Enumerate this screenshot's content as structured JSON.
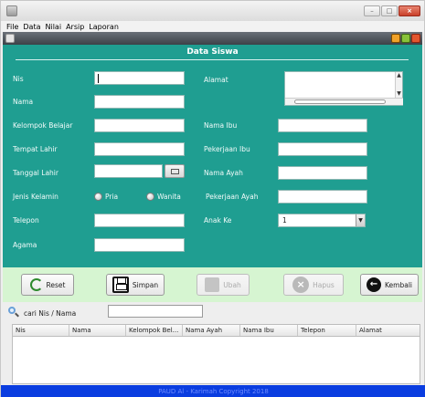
{
  "menu": [
    "File",
    "Data",
    "Nilai",
    "Arsip",
    "Laporan"
  ],
  "form": {
    "title": "Data Siswa",
    "left_labels": [
      "Nis",
      "Nama",
      "Kelompok Belajar",
      "Tempat Lahir",
      "Tanggal Lahir",
      "Jenis Kelamin",
      "Telepon",
      "Agama"
    ],
    "right_labels": [
      "Alamat",
      "Nama Ibu",
      "Pekerjaan Ibu",
      "Nama Ayah",
      "Pekerjaan Ayah",
      "Anak Ke"
    ],
    "gender_options": [
      "Pria",
      "Wanita"
    ],
    "anak_ke_value": "1"
  },
  "buttons": {
    "reset": "Reset",
    "simpan": "Simpan",
    "ubah": "Ubah",
    "hapus": "Hapus",
    "kembali": "Kembali"
  },
  "search": {
    "label": "cari Nis / Nama",
    "value": ""
  },
  "table": {
    "columns": [
      "Nis",
      "Nama",
      "Kelompok Bel...",
      "Nama Ayah",
      "Nama Ibu",
      "Telepon",
      "Alamat"
    ]
  },
  "footer": "PAUD Al - Karimah Copyright 2018",
  "colors": {
    "panel": "#1f9e91",
    "button_bar": "#d6f5d1",
    "footer": "#0a3de0"
  }
}
